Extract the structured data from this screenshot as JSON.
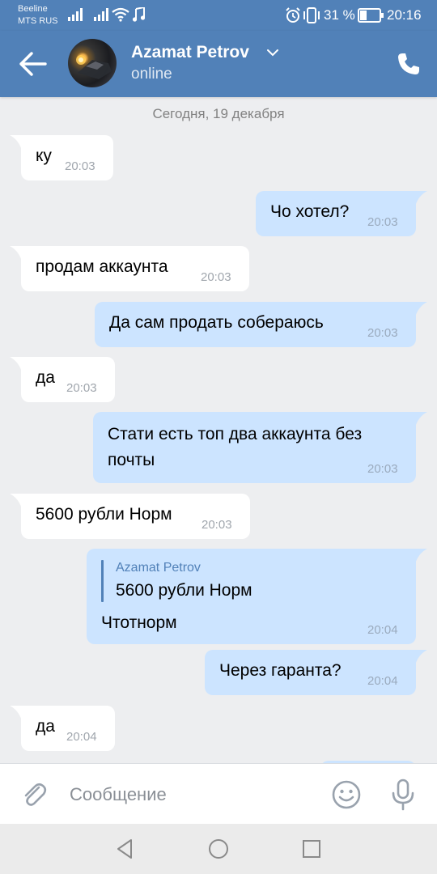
{
  "status_bar": {
    "carrier_1": "Beeline",
    "carrier_2": "MTS RUS",
    "battery_percent": "31 %",
    "time": "20:16"
  },
  "header": {
    "title": "Azamat Petrov",
    "subtitle": "online",
    "back_icon": "arrow-left-icon",
    "call_icon": "phone-icon"
  },
  "chat": {
    "date_separator": "Сегодня, 19 декабря",
    "messages": [
      {
        "dir": "in",
        "text": "ку",
        "time": "20:03"
      },
      {
        "dir": "out",
        "text": "Чо хотел?",
        "time": "20:03"
      },
      {
        "dir": "in",
        "text": "продам аккаунта",
        "time": "20:03"
      },
      {
        "dir": "out",
        "text": "Да сам продать собераюсь",
        "time": "20:03"
      },
      {
        "dir": "in",
        "text": "да",
        "time": "20:03"
      },
      {
        "dir": "out",
        "text_line1": "Стати есть топ два аккаунта без",
        "text_line2": "почты",
        "time": "20:03"
      },
      {
        "dir": "in",
        "text": "5600 рубли Норм",
        "time": "20:03"
      },
      {
        "dir": "out",
        "quote_author": "Azamat Petrov",
        "quote_text": "5600 рубли Норм",
        "text": "Чтотнорм",
        "time": "20:04"
      },
      {
        "dir": "out",
        "text": "Через гаранта?",
        "time": "20:04"
      },
      {
        "dir": "in",
        "text": "да",
        "time": "20:04"
      }
    ]
  },
  "composer": {
    "placeholder": "Сообщение",
    "attach_icon": "paperclip-icon",
    "emoji_icon": "smiley-icon",
    "mic_icon": "microphone-icon"
  },
  "colors": {
    "header": "#5181b8",
    "background": "#edeef0",
    "incoming_bubble": "#ffffff",
    "outgoing_bubble": "#cce4ff"
  }
}
